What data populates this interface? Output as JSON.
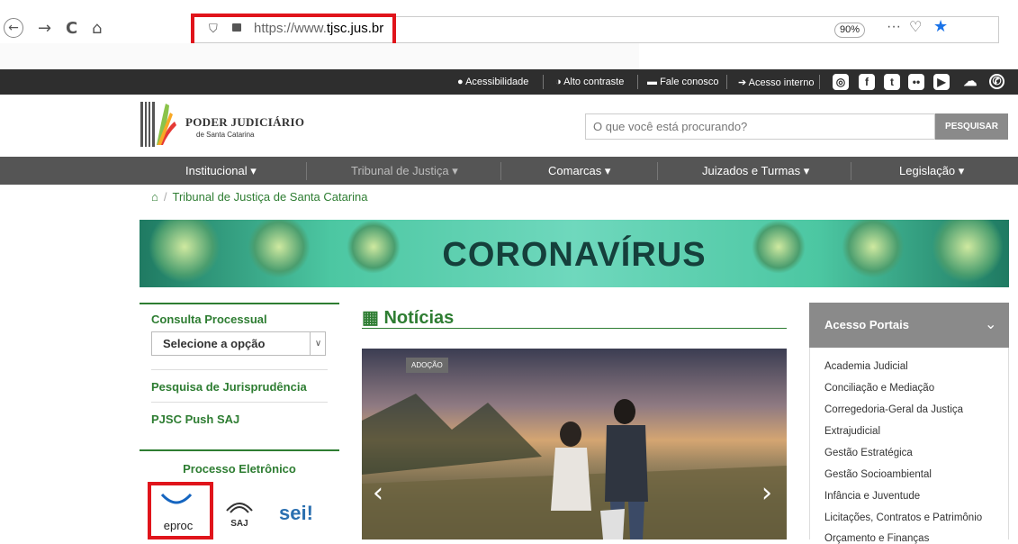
{
  "browser": {
    "url_prefix": "https://www.",
    "url_domain": "tjsc.jus.br",
    "zoom": "90%"
  },
  "topbar": {
    "links": [
      "Acessibilidade",
      "Alto contraste",
      "Fale conosco",
      "Acesso interno"
    ],
    "social": [
      "instagram-icon",
      "facebook-icon",
      "twitter-icon",
      "flickr-icon",
      "youtube-icon",
      "soundcloud-icon",
      "whatsapp-icon"
    ]
  },
  "header": {
    "logo_line1": "PODER JUDICIÁRIO",
    "logo_line2": "de Santa Catarina",
    "search_placeholder": "O que você está procurando?",
    "search_button": "PESQUISAR"
  },
  "nav": {
    "items": [
      "Institucional",
      "Tribunal de Justiça",
      "Comarcas",
      "Juizados e Turmas",
      "Legislação"
    ]
  },
  "breadcrumb": "Tribunal de Justiça de Santa Catarina",
  "banner_title": "CORONAVÍRUS",
  "left": {
    "consulta_title": "Consulta Processual",
    "select_value": "Selecione a opção",
    "jurisprudencia": "Pesquisa de Jurisprudência",
    "push": "PJSC Push SAJ",
    "processo_title": "Processo Eletrônico",
    "logos": [
      "eproc",
      "SAJ",
      "sei!"
    ]
  },
  "news": {
    "title": "Notícias",
    "tag": "ADOÇÃO"
  },
  "portals": {
    "title": "Acesso Portais",
    "items": [
      "Academia Judicial",
      "Conciliação e Mediação",
      "Corregedoria-Geral da Justiça",
      "Extrajudicial",
      "Gestão Estratégica",
      "Gestão Socioambiental",
      "Infância e Juventude",
      "Licitações, Contratos e Patrimônio",
      "Orçamento e Finanças"
    ]
  },
  "colors": {
    "green": "#2e7d32",
    "dark_bar": "#2e2e2e",
    "nav": "#555555",
    "highlight": "#e0141b"
  }
}
